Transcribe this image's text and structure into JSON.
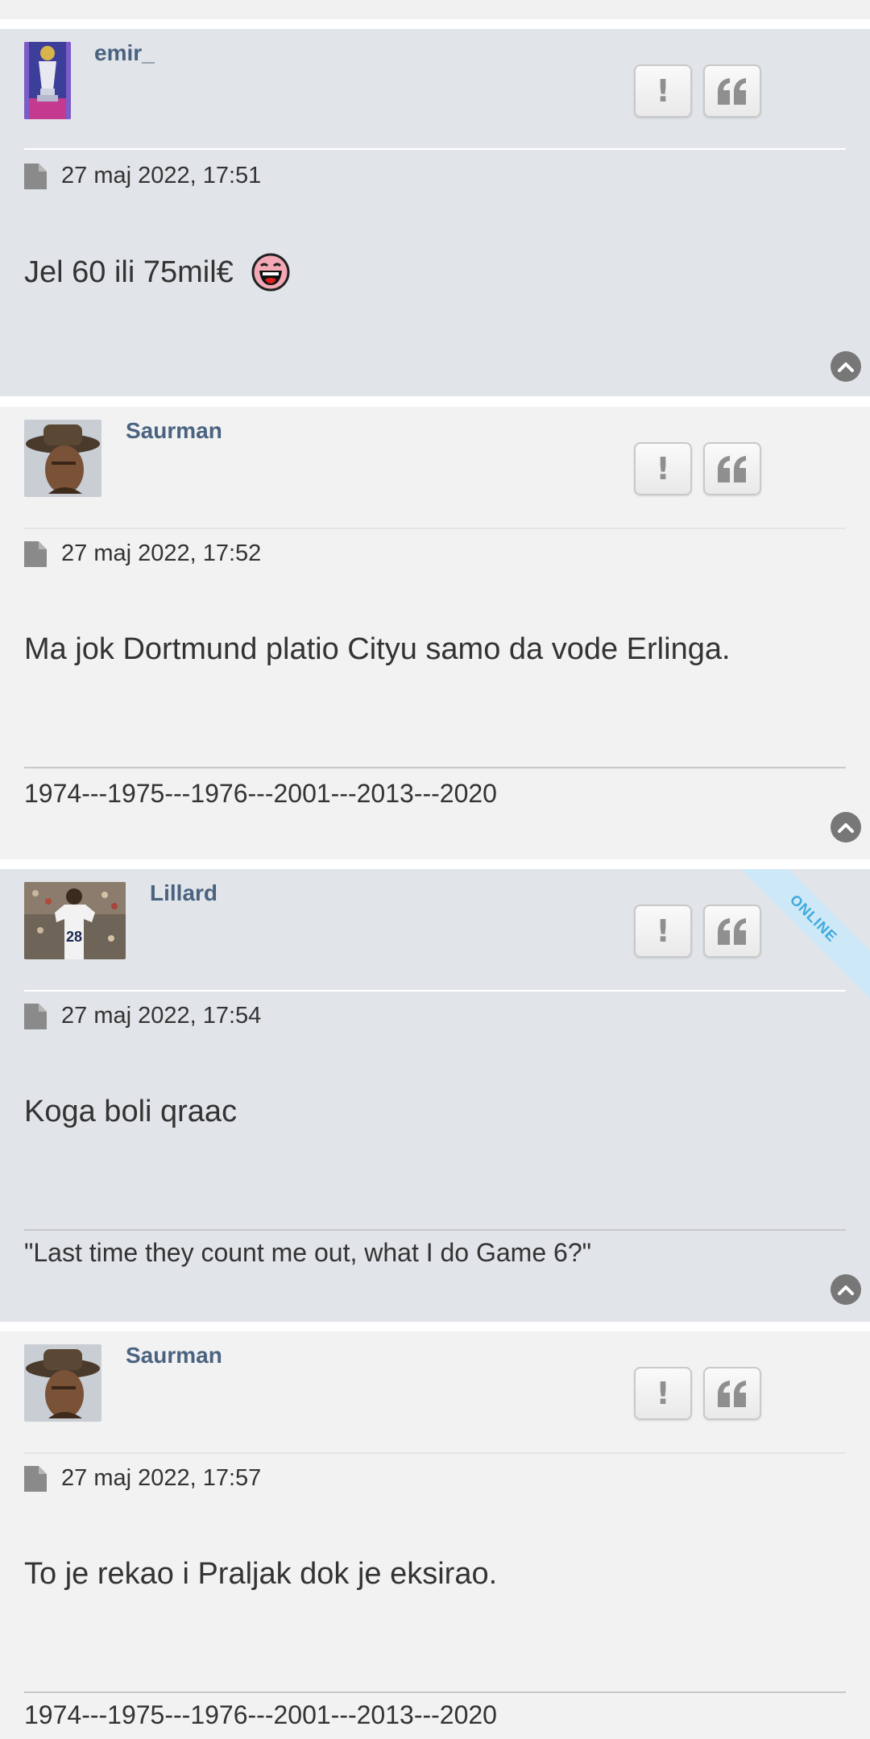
{
  "posts": [
    {
      "username": "emir_",
      "avatar": "premier-league-trophy-avatar",
      "date": "27 maj 2022, 17:51",
      "text": "Jel 60 ili 75mil€",
      "emoji": "laughing-emoji",
      "signature": ""
    },
    {
      "username": "Saurman",
      "avatar": "cowboy-hat-man-avatar",
      "date": "27 maj 2022, 17:52",
      "text": "Ma jok Dortmund platio Cityu samo da vode Erlinga.",
      "signature": "1974---1975---1976---2001---2013---2020"
    },
    {
      "username": "Lillard",
      "avatar": "player-28-avatar",
      "online": "ONLINE",
      "date": "27 maj 2022, 17:54",
      "text": "Koga boli qraac",
      "signature": "\"Last time they count me out, what I do Game 6?\""
    },
    {
      "username": "Saurman",
      "avatar": "cowboy-hat-man-avatar",
      "date": "27 maj 2022, 17:57",
      "text": "To je rekao i Praljak dok je eksirao.",
      "signature": "1974---1975---1976---2001---2013---2020"
    }
  ],
  "icons": {
    "report": "exclamation-icon",
    "quote": "quote-icon",
    "post_file": "file-icon",
    "back_to_top": "chevron-up-icon"
  },
  "colors": {
    "username": "#4a6381",
    "post_alt_bg": "#e1e4e8",
    "post_plain_bg": "#f2f2f2",
    "online_badge": "#3fa9e0"
  }
}
